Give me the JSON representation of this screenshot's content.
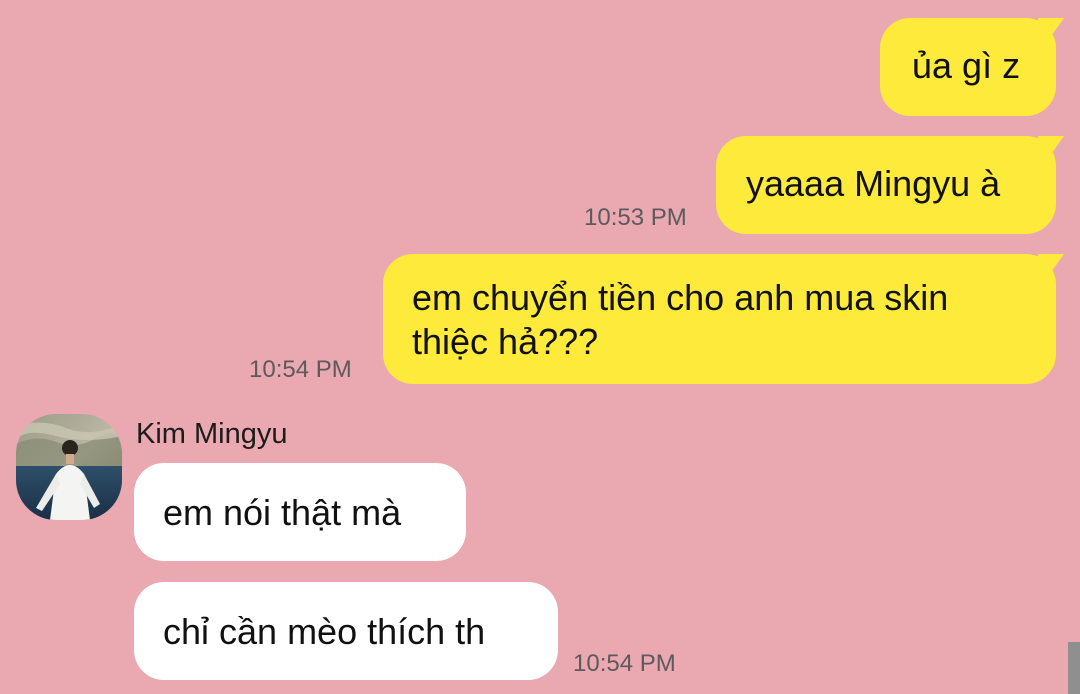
{
  "messages": [
    {
      "direction": "out",
      "text": "ủa gì z",
      "time": ""
    },
    {
      "direction": "out",
      "text": "yaaaa Mingyu à",
      "time": "10:53 PM"
    },
    {
      "direction": "out",
      "lines": [
        "em chuyển tiền cho anh mua skin",
        "thiệc hả???"
      ],
      "time": "10:54 PM"
    }
  ],
  "contact": {
    "name": "Kim Mingyu",
    "avatar_icon": "profile-photo"
  },
  "incoming": [
    {
      "direction": "in",
      "text": "em nói thật mà",
      "time": ""
    },
    {
      "direction": "in",
      "text": "chỉ cần mèo thích th",
      "time": "10:54 PM"
    }
  ],
  "colors": {
    "background": "#eaa8b0",
    "outgoing_bubble": "#fdea3a",
    "incoming_bubble": "#ffffff",
    "timestamp": "#5d5a5c"
  }
}
